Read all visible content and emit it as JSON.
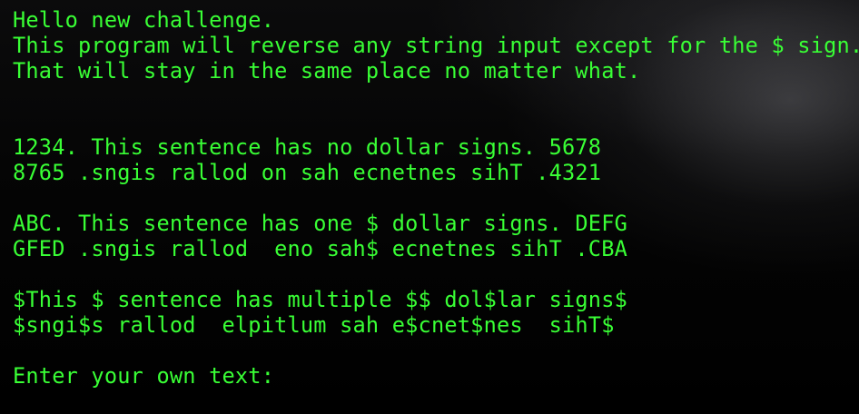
{
  "terminal": {
    "text_color": "#39ff35",
    "lines": [
      "Hello new challenge.",
      "This program will reverse any string input except for the $ sign.",
      "That will stay in the same place no matter what.",
      "",
      "",
      "1234. This sentence has no dollar signs. 5678",
      "8765 .sngis rallod on sah ecnetnes sihT .4321",
      "",
      "ABC. This sentence has one $ dollar signs. DEFG",
      "GFED .sngis rallod  eno sah$ ecnetnes sihT .CBA",
      "",
      "$This $ sentence has multiple $$ dol$lar signs$",
      "$sngi$s rallod  elpitlum sah e$cnet$nes  sihT$",
      "",
      "Enter your own text:"
    ]
  }
}
